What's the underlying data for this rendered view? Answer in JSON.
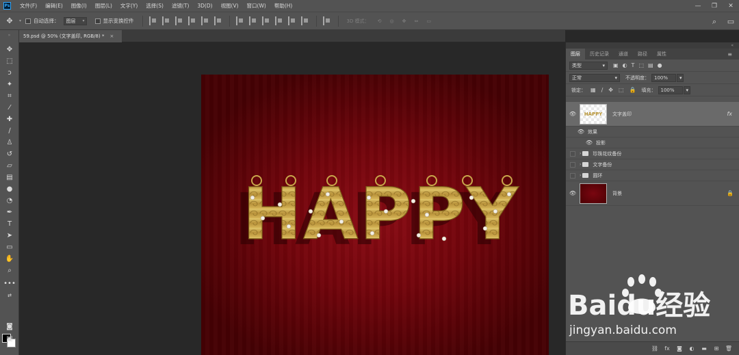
{
  "menubar": {
    "items": [
      "文件(F)",
      "编辑(E)",
      "图像(I)",
      "图层(L)",
      "文字(Y)",
      "选择(S)",
      "滤镜(T)",
      "3D(D)",
      "视图(V)",
      "窗口(W)",
      "帮助(H)"
    ],
    "logo": "Ps",
    "window_controls": [
      "—",
      "❐",
      "✕"
    ]
  },
  "options": {
    "auto_select_label": "自动选择：",
    "auto_select_value": "图层",
    "transform_label": "显示变换控件",
    "mode_3d_label": "3D 模式：",
    "icons": [
      "move-icon",
      "search-icon",
      "workspace-icon"
    ]
  },
  "document": {
    "tab_title": "59.psd @ 50% (文字盖印, RGB/8) *",
    "close": "×"
  },
  "artwork": {
    "text": "HAPPY",
    "bg_color": "#70050b",
    "letter_color": "#c9a74b"
  },
  "panel": {
    "tabs": [
      "图层",
      "历史记录",
      "通道",
      "路径",
      "属性"
    ],
    "active_tab": "图层",
    "filter_kind": "类型",
    "blend_mode": "正常",
    "opacity_label": "不透明度：",
    "opacity_value": "100%",
    "lock_label": "锁定：",
    "fill_label": "填充：",
    "fill_value": "100%",
    "layers": [
      {
        "name": "文字盖印",
        "thumb_text": "HAPPY",
        "fx": "fx",
        "visible": true,
        "selected": true
      },
      {
        "name": "效果",
        "visible": true,
        "sub": true
      },
      {
        "name": "投影",
        "visible": true,
        "sub": true
      },
      {
        "name": "珍珠花纹备份",
        "visible": false,
        "folder": true
      },
      {
        "name": "文字备份",
        "visible": false,
        "folder": true
      },
      {
        "name": "圆环",
        "visible": false,
        "folder": true
      },
      {
        "name": "背景",
        "visible": true
      }
    ]
  },
  "watermark": {
    "brand": "Baidu经验",
    "url": "jingyan.baidu.com"
  }
}
